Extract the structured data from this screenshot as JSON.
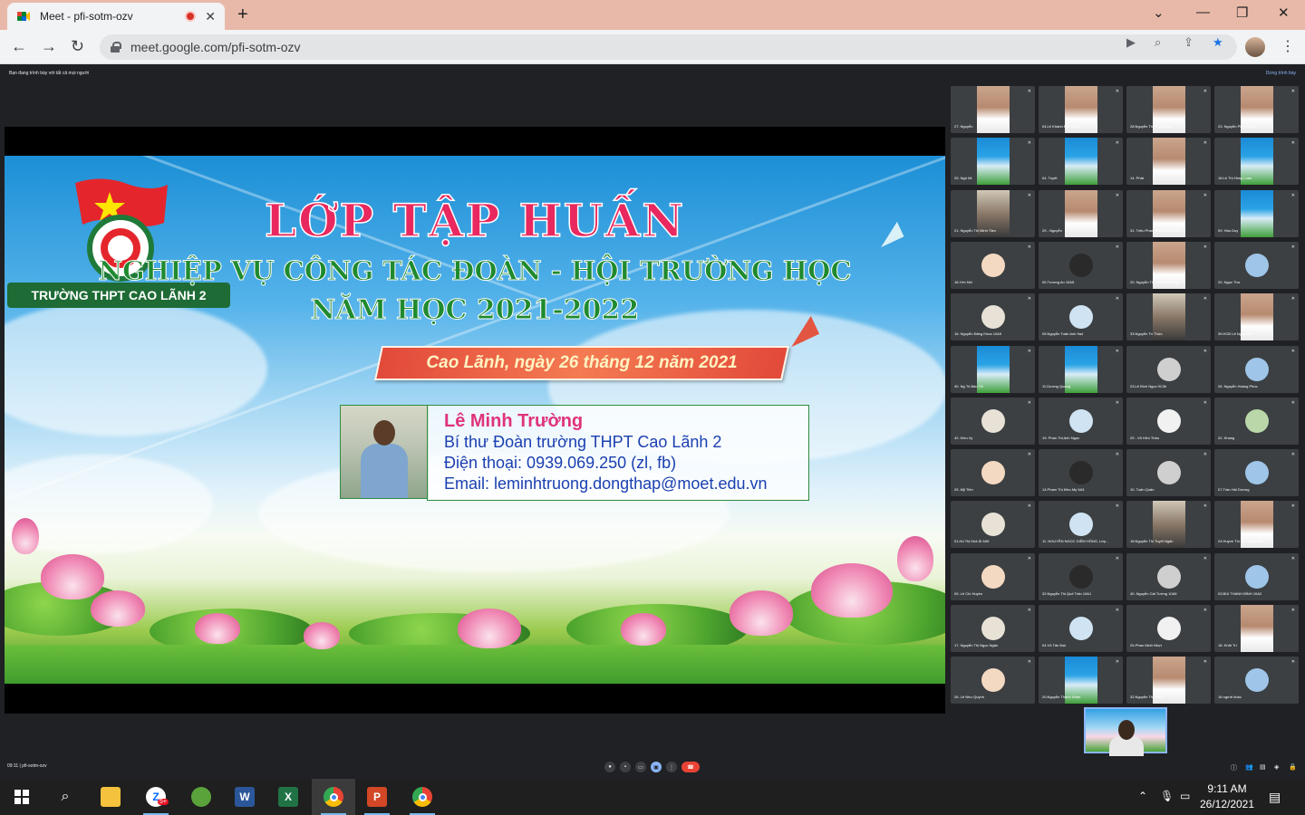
{
  "browser": {
    "tab_title": "Meet - pfi-sotm-ozv",
    "url": "meet.google.com/pfi-sotm-ozv",
    "new_tab": "+",
    "tab_close": "✕"
  },
  "meet": {
    "presenting_note": "Bạn đang trình bày với tất cả mọi người",
    "stop_presenting": "Dừng trình bày",
    "meeting_info": "09:11  |  pfi-sotm-ozv",
    "slide": {
      "school": "TRƯỜNG THPT CAO LÃNH 2",
      "title": "LỚP TẬP HUẤN",
      "subtitle": "NGHIỆP VỤ CÔNG TÁC ĐOÀN - HỘI TRƯỜNG HỌC",
      "year": "NĂM HỌC 2021-2022",
      "date": "Cao Lãnh, ngày 26 tháng 12 năm 2021",
      "presenter_name": "Lê Minh Trường",
      "presenter_role": "Bí thư Đoàn trường THPT Cao Lãnh 2",
      "presenter_phone": "Điện thoại: 0939.069.250 (zl, fb)",
      "presenter_email": "Email: leminhtruong.dongthap@moet.edu.vn"
    },
    "participants": [
      {
        "name": "27. Nguyễn",
        "style": "face"
      },
      {
        "name": "04.Lê Khánh Đan 10C2",
        "style": "face"
      },
      {
        "name": "28.Nguyễn Thị Thanh Thư",
        "style": "face"
      },
      {
        "name": "23. Nguyễn Phúc Thịnh",
        "style": "face"
      },
      {
        "name": "29. Ngô Mi",
        "style": "jersey"
      },
      {
        "name": "04. Tuyết",
        "style": "jersey"
      },
      {
        "name": "14. Phát",
        "style": "face"
      },
      {
        "name": "18.Lê Thị Hồng Loan",
        "style": "jersey"
      },
      {
        "name": "21. Nguyễn Thị Minh Tâm",
        "style": "dark"
      },
      {
        "name": "29 - Nguyễn",
        "style": "face"
      },
      {
        "name": "31. Triệu Phạm Minh Thư 10A3",
        "style": "face"
      },
      {
        "name": "09. Hầu Duy",
        "style": "jersey"
      },
      {
        "name": "18.Yến Nhi",
        "style": "circle"
      },
      {
        "name": "09.Trương An 10A5",
        "style": "circle"
      },
      {
        "name": "20. Nguyễn Thị Thanh Hương",
        "style": "face"
      },
      {
        "name": "20. Ngọc Thư",
        "style": "circle"
      },
      {
        "name": "16. Nguyễn Đăng Khoa 10A5",
        "style": "circle"
      },
      {
        "name": "05.Nguyễn Tuấn Anh 9a4",
        "style": "circle"
      },
      {
        "name": "33.Nguyễn Trí Thức",
        "style": "dark"
      },
      {
        "name": "39.HCĐ Lê Ngọc Anh",
        "style": "face"
      },
      {
        "name": "40. Ng Trị Bảo Thi",
        "style": "jersey"
      },
      {
        "name": "11.Dương Quang",
        "style": "jersey"
      },
      {
        "name": "23.Lê Bích Ngọc 9C3b",
        "style": "circle"
      },
      {
        "name": "26. Nguyễn Hoàng Phúc",
        "style": "circle"
      },
      {
        "name": "42. Kiều Vy",
        "style": "circle"
      },
      {
        "name": "19. Phan Thị Anh Ngọc",
        "style": "circle"
      },
      {
        "name": "29 - Võ Hữu Thảo",
        "style": "circle"
      },
      {
        "name": "22. Khang",
        "style": "circle"
      },
      {
        "name": "25. Mỹ Tiên",
        "style": "circle"
      },
      {
        "name": "14.Phạm Thị Kiều My 9A3",
        "style": "circle"
      },
      {
        "name": "10. Tuấn Quân",
        "style": "circle"
      },
      {
        "name": "07.Trần Hải Dương",
        "style": "circle"
      },
      {
        "name": "01.Hồ Thị Khả Ái 9A5",
        "style": "circle"
      },
      {
        "name": "11. NGUYỄN NGỌC DIỄM HỒNG, Lớp...",
        "style": "circle"
      },
      {
        "name": "18.Nguyễn Thị Tuyết Ngân",
        "style": "dark"
      },
      {
        "name": "24.Huỳnh Thị Kim Ngân 9a5",
        "style": "face"
      },
      {
        "name": "09. Lê Chí Huyền",
        "style": "circle"
      },
      {
        "name": "32.Nguyễn Thị Quế Trân 10A1",
        "style": "circle"
      },
      {
        "name": "40. Nguyễn Cát Tường 10A5",
        "style": "circle"
      },
      {
        "name": "03.BÙI THANH BÌNH 10A2",
        "style": "circle"
      },
      {
        "name": "17. Nguyễn Thị Ngọc Ngân",
        "style": "circle"
      },
      {
        "name": "04.Võ Tấn Đạt",
        "style": "circle"
      },
      {
        "name": "25-Phan Minh Nhựt",
        "style": "circle"
      },
      {
        "name": "18. Khởi Trí",
        "style": "face"
      },
      {
        "name": "26. Lê Như Quỳnh",
        "style": "circle"
      },
      {
        "name": "20.Nguyễn Thành Nhân",
        "style": "jersey"
      },
      {
        "name": "32.Nguyễn Thị Trâm",
        "style": "face"
      },
      {
        "name": "16 người khác",
        "style": "circle"
      }
    ]
  },
  "taskbar": {
    "time": "9:11 AM",
    "date": "26/12/2021",
    "zalo_badge": "5+",
    "word": "W",
    "excel": "X",
    "powerpoint": "P"
  }
}
